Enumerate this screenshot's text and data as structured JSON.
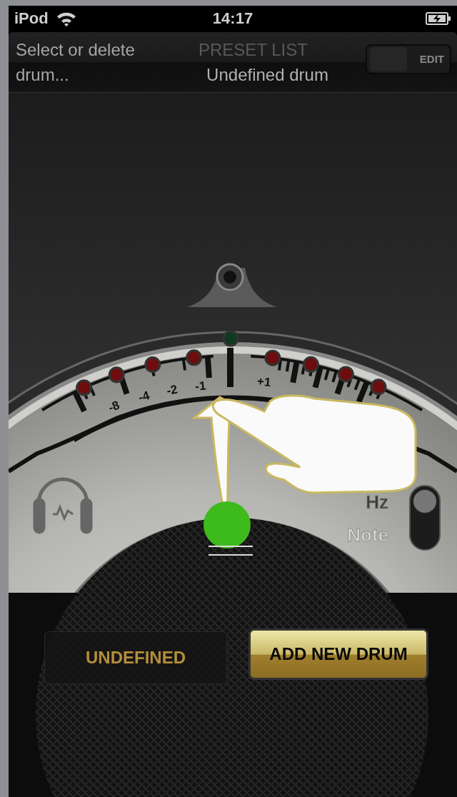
{
  "status_bar": {
    "carrier": "iPod",
    "time": "14:17"
  },
  "header": {
    "hint": "Select or delete drum...",
    "title": "PRESET LIST",
    "preset": "Undefined drum",
    "edit_switch": {
      "label": "EDIT",
      "on": false
    }
  },
  "tuner": {
    "scale_labels": [
      "-8",
      "-4",
      "-2",
      "-1",
      "+1"
    ],
    "leds": [
      {
        "color": "#6e0d0d"
      },
      {
        "color": "#6e0d0d"
      },
      {
        "color": "#6e0d0d"
      },
      {
        "color": "#6e0d0d"
      },
      {
        "color": "#0e3a20"
      },
      {
        "color": "#6e0d0d"
      },
      {
        "color": "#6e0d0d"
      },
      {
        "color": "#6e0d0d"
      },
      {
        "color": "#6e0d0d"
      }
    ],
    "mode_switch": [
      {
        "label": "Hz",
        "selected": true
      },
      {
        "label": "Note",
        "selected": false
      }
    ]
  },
  "drum_name": "UNDEFINED",
  "add_button": "ADD NEW DRUM"
}
